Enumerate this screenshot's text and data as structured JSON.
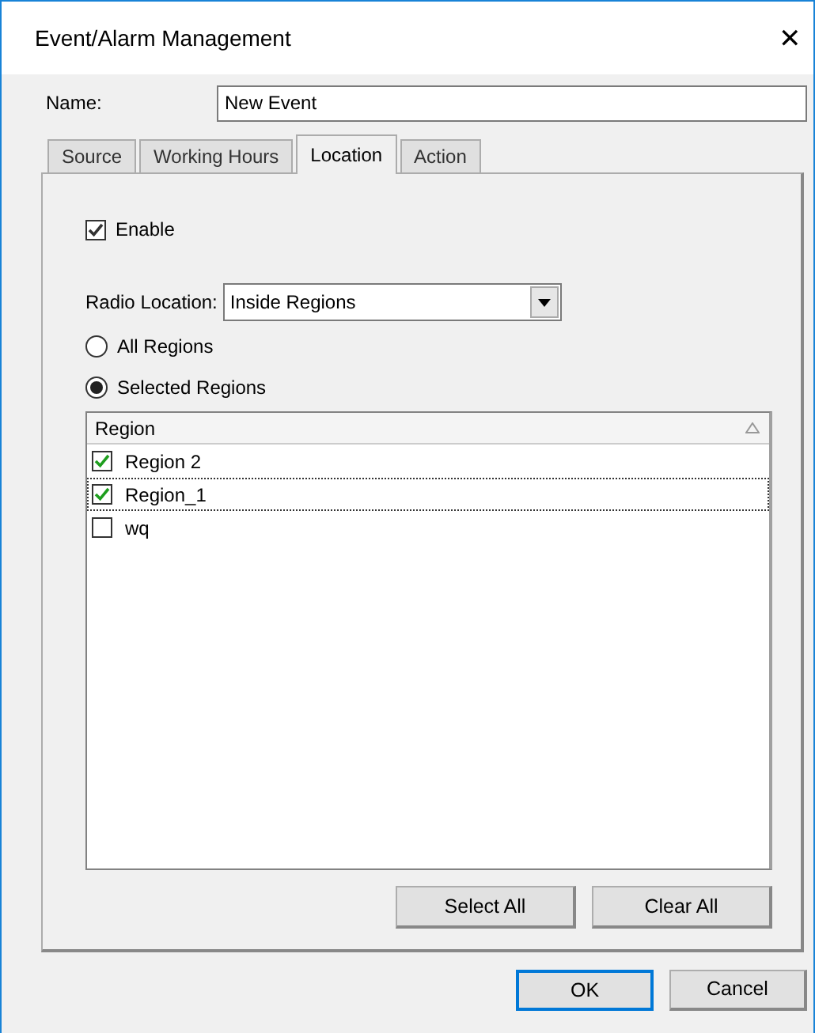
{
  "window": {
    "title": "Event/Alarm Management",
    "close": "✕"
  },
  "name_field": {
    "label": "Name:",
    "value": "New Event"
  },
  "tabs": [
    {
      "label": "Source",
      "selected": false
    },
    {
      "label": "Working Hours",
      "selected": false
    },
    {
      "label": "Location",
      "selected": true
    },
    {
      "label": "Action",
      "selected": false
    }
  ],
  "enable": {
    "label": "Enable",
    "checked": true
  },
  "radio_location": {
    "label": "Radio Location:",
    "value": "Inside Regions"
  },
  "region_mode": [
    {
      "label": "All Regions",
      "selected": false
    },
    {
      "label": "Selected Regions",
      "selected": true
    }
  ],
  "table": {
    "columns": [
      "Region"
    ],
    "rows": [
      {
        "region": "Region 2",
        "checked": true,
        "selected": false
      },
      {
        "region": "Region_1",
        "checked": true,
        "selected": true
      },
      {
        "region": "wq",
        "checked": false,
        "selected": false
      }
    ]
  },
  "list_buttons": [
    "Select All",
    "Clear All"
  ],
  "buttons": [
    {
      "label": "OK",
      "default": true
    },
    {
      "label": "Cancel",
      "default": false
    }
  ]
}
